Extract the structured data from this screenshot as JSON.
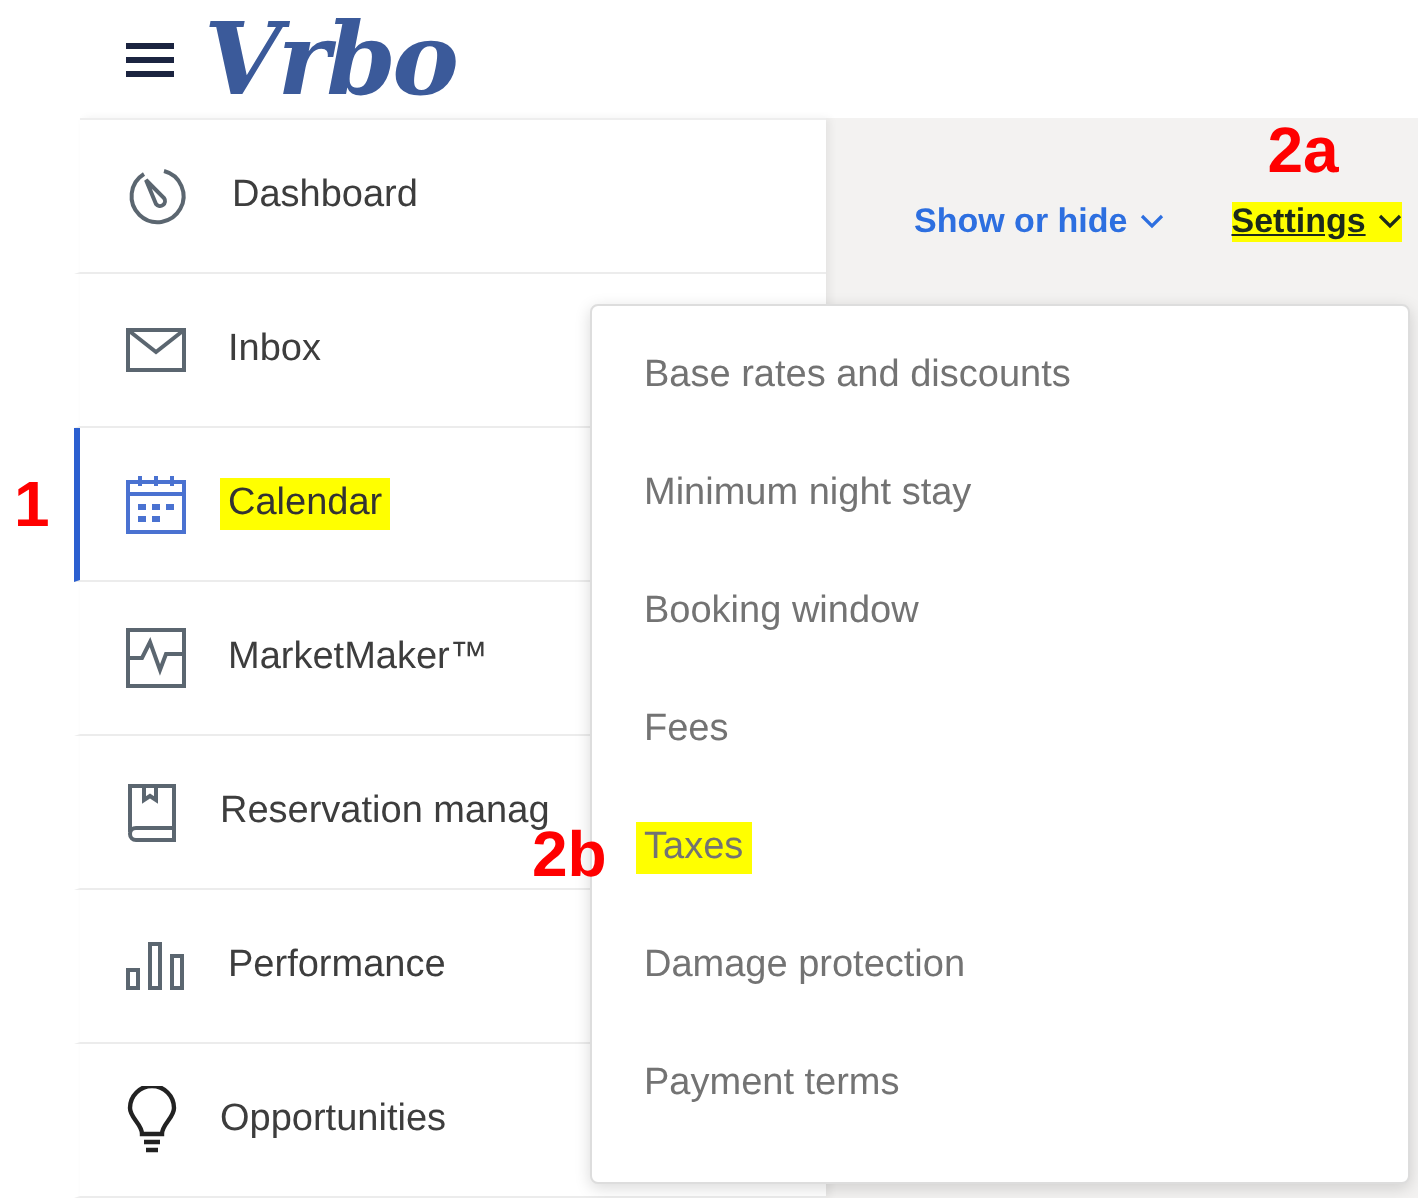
{
  "header": {
    "logo": "Vrbo"
  },
  "nav": [
    {
      "label": "Dashboard",
      "selected": false,
      "highlighted": false
    },
    {
      "label": "Inbox",
      "selected": false,
      "highlighted": false
    },
    {
      "label": "Calendar",
      "selected": true,
      "highlighted": true,
      "annotation": "1"
    },
    {
      "label": "MarketMaker™",
      "selected": false,
      "highlighted": false
    },
    {
      "label": "Reservation manag",
      "selected": false,
      "highlighted": false
    },
    {
      "label": "Performance",
      "selected": false,
      "highlighted": false
    },
    {
      "label": "Opportunities",
      "selected": false,
      "highlighted": false
    }
  ],
  "toolbar": [
    {
      "label": "Show or hide",
      "highlighted": false
    },
    {
      "label": "Settings",
      "highlighted": true,
      "annotation": "2a"
    }
  ],
  "settings_menu": [
    {
      "label": "Base rates and discounts",
      "highlighted": false
    },
    {
      "label": "Minimum night stay",
      "highlighted": false
    },
    {
      "label": "Booking window",
      "highlighted": false
    },
    {
      "label": "Fees",
      "highlighted": false
    },
    {
      "label": "Taxes",
      "highlighted": true,
      "annotation": "2b"
    },
    {
      "label": "Damage protection",
      "highlighted": false
    },
    {
      "label": "Payment terms",
      "highlighted": false
    }
  ]
}
